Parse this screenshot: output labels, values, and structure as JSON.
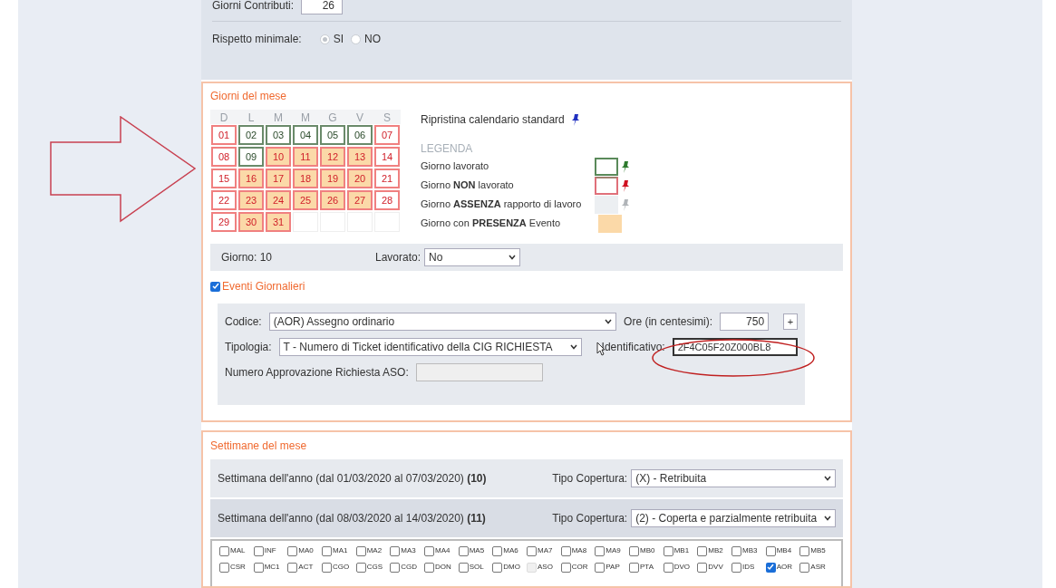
{
  "top": {
    "contributi_label": "Giorni Contributi:",
    "contributi_value": "26",
    "minimale_label": "Rispetto minimale:",
    "options": [
      {
        "label": "SI",
        "selected": true
      },
      {
        "label": "NO",
        "selected": false
      }
    ]
  },
  "giorni": {
    "title": "Giorni del mese",
    "weekdays": [
      "D",
      "L",
      "M",
      "M",
      "G",
      "V",
      "S"
    ],
    "days": [
      {
        "label": "01",
        "worked": false,
        "event": false
      },
      {
        "label": "02",
        "worked": true,
        "event": false
      },
      {
        "label": "03",
        "worked": true,
        "event": false
      },
      {
        "label": "04",
        "worked": true,
        "event": false
      },
      {
        "label": "05",
        "worked": true,
        "event": false
      },
      {
        "label": "06",
        "worked": true,
        "event": false
      },
      {
        "label": "07",
        "worked": false,
        "event": false
      },
      {
        "label": "08",
        "worked": false,
        "event": false
      },
      {
        "label": "09",
        "worked": true,
        "event": false
      },
      {
        "label": "10",
        "worked": false,
        "event": true
      },
      {
        "label": "11",
        "worked": false,
        "event": true
      },
      {
        "label": "12",
        "worked": false,
        "event": true
      },
      {
        "label": "13",
        "worked": false,
        "event": true
      },
      {
        "label": "14",
        "worked": false,
        "event": false
      },
      {
        "label": "15",
        "worked": false,
        "event": false
      },
      {
        "label": "16",
        "worked": false,
        "event": true
      },
      {
        "label": "17",
        "worked": false,
        "event": true
      },
      {
        "label": "18",
        "worked": false,
        "event": true
      },
      {
        "label": "19",
        "worked": false,
        "event": true
      },
      {
        "label": "20",
        "worked": false,
        "event": true
      },
      {
        "label": "21",
        "worked": false,
        "event": false
      },
      {
        "label": "22",
        "worked": false,
        "event": false
      },
      {
        "label": "23",
        "worked": false,
        "event": true
      },
      {
        "label": "24",
        "worked": false,
        "event": true
      },
      {
        "label": "25",
        "worked": false,
        "event": true
      },
      {
        "label": "26",
        "worked": false,
        "event": true
      },
      {
        "label": "27",
        "worked": false,
        "event": true
      },
      {
        "label": "28",
        "worked": false,
        "event": false
      },
      {
        "label": "29",
        "worked": false,
        "event": false
      },
      {
        "label": "30",
        "worked": false,
        "event": true
      },
      {
        "label": "31",
        "worked": false,
        "event": true
      }
    ],
    "restore_link": "Ripristina calendario standard",
    "legend_title": "LEGENDA",
    "legend": [
      {
        "kind": "worked",
        "label": "Giorno lavorato"
      },
      {
        "kind": "nonworked",
        "label": "Giorno **NON** lavorato"
      },
      {
        "kind": "absence",
        "label": "Giorno **ASSENZA** rapporto di lavoro"
      },
      {
        "kind": "event",
        "label": "Giorno con **PRESENZA** Evento"
      }
    ],
    "day_label": "Giorno: 10",
    "lavorato_label": "Lavorato:",
    "lavorato_value": "No",
    "eventi": {
      "label": "Eventi Giornalieri",
      "checked": true,
      "codice_label": "Codice:",
      "codice_value": "(AOR) Assegno ordinario",
      "ore_label": "Ore (in centesimi):",
      "ore_value": "750",
      "add_button": "+",
      "tipologia_label": "Tipologia:",
      "tipologia_value": "T - Numero di Ticket identificativo della CIG RICHIESTA",
      "ident_label": "Identificativo:",
      "ident_value": "2F4C05F20Z000BL8",
      "aso_label": "Numero Approvazione Richiesta ASO:"
    }
  },
  "settimane": {
    "title": "Settimane del mese",
    "weeks": [
      {
        "label": "Settimana dell'anno (dal 01/03/2020 al 07/03/2020) **(10)**",
        "tipo_label": "Tipo Copertura:",
        "tipo_value": "(X) - Retribuita",
        "selected": false
      },
      {
        "label": "Settimana dell'anno (dal 08/03/2020 al 14/03/2020) **(11)**",
        "tipo_label": "Tipo Copertura:",
        "tipo_value": "(2) - Coperta e parzialmente retribuita",
        "selected": true
      }
    ],
    "codes": [
      {
        "label": "MAL",
        "checked": false,
        "disabled": false
      },
      {
        "label": "INF",
        "checked": false,
        "disabled": false
      },
      {
        "label": "MA0",
        "checked": false,
        "disabled": false
      },
      {
        "label": "MA1",
        "checked": false,
        "disabled": false
      },
      {
        "label": "MA2",
        "checked": false,
        "disabled": false
      },
      {
        "label": "MA3",
        "checked": false,
        "disabled": false
      },
      {
        "label": "MA4",
        "checked": false,
        "disabled": false
      },
      {
        "label": "MA5",
        "checked": false,
        "disabled": false
      },
      {
        "label": "MA6",
        "checked": false,
        "disabled": false
      },
      {
        "label": "MA7",
        "checked": false,
        "disabled": false
      },
      {
        "label": "MA8",
        "checked": false,
        "disabled": false
      },
      {
        "label": "MA9",
        "checked": false,
        "disabled": false
      },
      {
        "label": "MB0",
        "checked": false,
        "disabled": false
      },
      {
        "label": "MB1",
        "checked": false,
        "disabled": false
      },
      {
        "label": "MB2",
        "checked": false,
        "disabled": false
      },
      {
        "label": "MB3",
        "checked": false,
        "disabled": false
      },
      {
        "label": "MB4",
        "checked": false,
        "disabled": false
      },
      {
        "label": "MB5",
        "checked": false,
        "disabled": false
      },
      {
        "label": "CSR",
        "checked": false,
        "disabled": false
      },
      {
        "label": "MC1",
        "checked": false,
        "disabled": false
      },
      {
        "label": "ACT",
        "checked": false,
        "disabled": false
      },
      {
        "label": "CGO",
        "checked": false,
        "disabled": false
      },
      {
        "label": "CGS",
        "checked": false,
        "disabled": false
      },
      {
        "label": "CGD",
        "checked": false,
        "disabled": false
      },
      {
        "label": "DON",
        "checked": false,
        "disabled": false
      },
      {
        "label": "SOL",
        "checked": false,
        "disabled": false
      },
      {
        "label": "DMO",
        "checked": false,
        "disabled": false
      },
      {
        "label": "ASO",
        "checked": false,
        "disabled": true
      },
      {
        "label": "COR",
        "checked": false,
        "disabled": false
      },
      {
        "label": "PAP",
        "checked": false,
        "disabled": false
      },
      {
        "label": "PTA",
        "checked": false,
        "disabled": false
      },
      {
        "label": "DVO",
        "checked": false,
        "disabled": false
      },
      {
        "label": "DVV",
        "checked": false,
        "disabled": false
      },
      {
        "label": "IDS",
        "checked": false,
        "disabled": false
      },
      {
        "label": "AOR",
        "checked": true,
        "disabled": false
      },
      {
        "label": "ASR",
        "checked": false,
        "disabled": false
      }
    ]
  }
}
